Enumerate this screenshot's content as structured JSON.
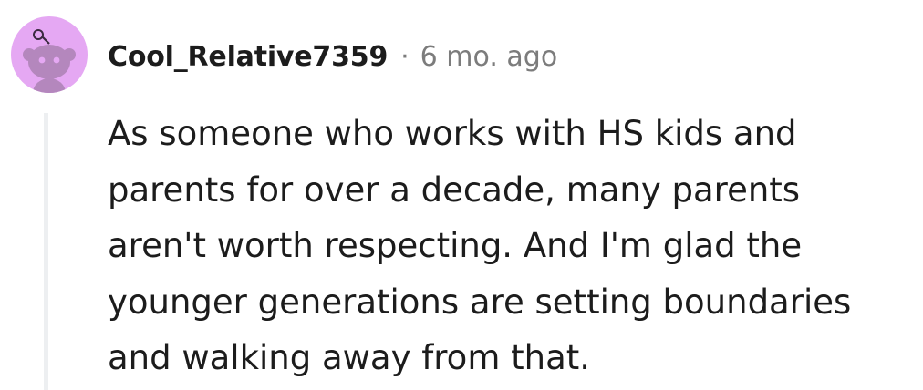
{
  "comment": {
    "author": "Cool_Relative7359",
    "separator": "·",
    "timestamp": "6 mo. ago",
    "avatar_icon": "reddit-snoo-avatar-icon",
    "avatar_color": "#e5a8f3",
    "body_lines": [
      "As someone who works with HS kids and",
      "parents for over a decade, many parents",
      "aren't worth respecting. And I'm glad the",
      "younger generations are setting boundaries",
      "and walking away from that."
    ]
  }
}
